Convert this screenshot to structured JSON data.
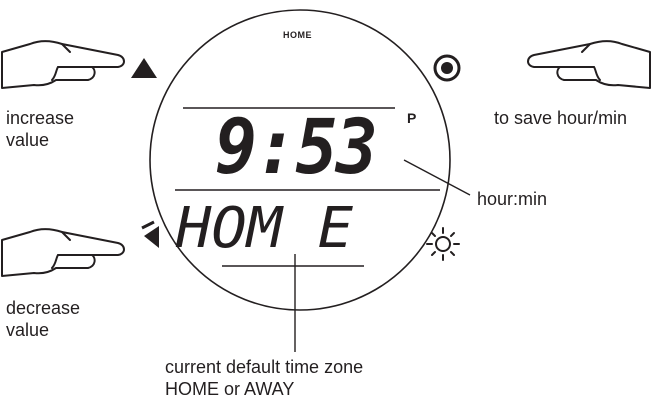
{
  "watch": {
    "mode_label": "HOME",
    "time": "9:53",
    "ampm": "P",
    "zone_display": "HOM E",
    "colors": {
      "ink": "#231f20",
      "background": "#ffffff"
    }
  },
  "buttons": {
    "upper_left": {
      "icon": "triangle-up-icon",
      "hand_icon": "pointing-hand-icon"
    },
    "lower_left": {
      "icon": "triangle-left-icon",
      "hand_icon": "pointing-hand-icon"
    },
    "upper_right": {
      "icon": "target-button-icon",
      "hand_icon": "pointing-hand-icon"
    },
    "light": {
      "icon": "sun-light-icon"
    }
  },
  "labels": {
    "increase_line1": "increase",
    "increase_line2": "value",
    "decrease_line1": "decrease",
    "decrease_line2": "value",
    "save": "to save hour/min",
    "hour_min": "hour:min",
    "zone_line1": "current default time zone",
    "zone_line2": "HOME or AWAY"
  }
}
